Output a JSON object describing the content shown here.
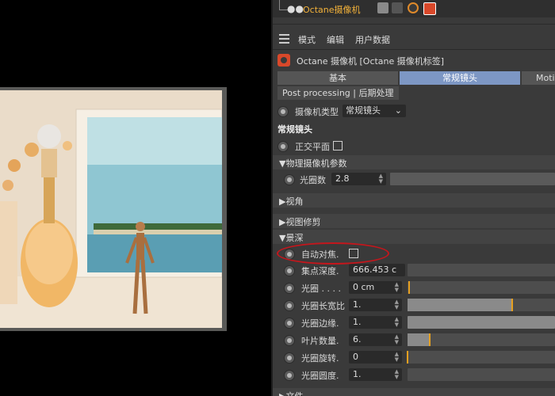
{
  "object_bar": {
    "camera_name": "Octane摄像机"
  },
  "menu": {
    "items": [
      "模式",
      "编辑",
      "用户数据"
    ]
  },
  "title": "Octane 摄像机 [Octane 摄像机标签]",
  "tabs": [
    "基本",
    "常规镜头",
    "Moti"
  ],
  "post_tab": "Post processing | 后期处理",
  "camera_type": {
    "label": "摄像机类型",
    "value": "常规镜头"
  },
  "section_heading": "常规镜头",
  "ortho": {
    "label": "正交平面"
  },
  "groups": {
    "physical": "▼物理摄像机参数",
    "view": "▶视角",
    "correction": "▶视图修剪",
    "dof": "▼景深",
    "file": "▶文件"
  },
  "aperture_number": {
    "label": "光圈数",
    "value": "2.8"
  },
  "dof_params": {
    "autofocus": "自动对焦.",
    "focal_depth": {
      "label": "集点深度.",
      "value": "666.453 c"
    },
    "aperture": {
      "label": "光圈 . . . .",
      "value": "0 cm",
      "fraction": 0.01
    },
    "aspect": {
      "label": "光圈长宽比",
      "value": "1.",
      "fraction": 0.71
    },
    "edge": {
      "label": "光圈边缘.",
      "value": "1."
    },
    "blades": {
      "label": "叶片数量.",
      "value": "6.",
      "fraction": 0.15
    },
    "rotation": {
      "label": "光圈旋转.",
      "value": "0",
      "fraction": 0.0
    },
    "roundness": {
      "label": "光圈圆度.",
      "value": "1."
    }
  },
  "colors": {
    "accent": "#f3b23a",
    "tab_active": "#7d97c4",
    "marker": "#e6a020",
    "highlight": "#c4161c"
  }
}
